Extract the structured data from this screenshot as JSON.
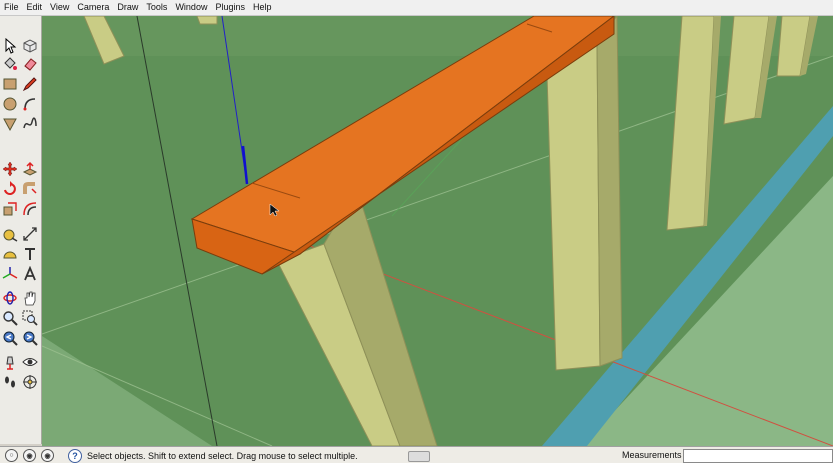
{
  "menubar": {
    "items": [
      {
        "id": "file",
        "label": "File"
      },
      {
        "id": "edit",
        "label": "Edit"
      },
      {
        "id": "view",
        "label": "View"
      },
      {
        "id": "camera",
        "label": "Camera"
      },
      {
        "id": "draw",
        "label": "Draw"
      },
      {
        "id": "tools",
        "label": "Tools"
      },
      {
        "id": "window",
        "label": "Window"
      },
      {
        "id": "plugins",
        "label": "Plugins"
      },
      {
        "id": "help",
        "label": "Help"
      }
    ]
  },
  "toolbar": {
    "tools": [
      {
        "name": "select-tool",
        "icon": "arrow"
      },
      {
        "name": "make-component-tool",
        "icon": "cube"
      },
      {
        "name": "paint-bucket-tool",
        "icon": "bucket"
      },
      {
        "name": "eraser-tool",
        "icon": "eraser"
      },
      {
        "name": "rectangle-tool",
        "icon": "rectangle"
      },
      {
        "name": "line-tool",
        "icon": "pencil"
      },
      {
        "name": "circle-tool",
        "icon": "circle"
      },
      {
        "name": "arc-tool",
        "icon": "arc"
      },
      {
        "name": "polygon-tool",
        "icon": "triangle"
      },
      {
        "name": "freehand-tool",
        "icon": "freehand"
      },
      {
        "name": "move-tool",
        "icon": "move"
      },
      {
        "name": "push-pull-tool",
        "icon": "pushpull"
      },
      {
        "name": "rotate-tool",
        "icon": "rotate"
      },
      {
        "name": "follow-me-tool",
        "icon": "followme"
      },
      {
        "name": "scale-tool",
        "icon": "scale"
      },
      {
        "name": "offset-tool",
        "icon": "offset"
      },
      {
        "name": "tape-measure-tool",
        "icon": "tape"
      },
      {
        "name": "dimension-tool",
        "icon": "dimension"
      },
      {
        "name": "protractor-tool",
        "icon": "protractor"
      },
      {
        "name": "text-tool",
        "icon": "text"
      },
      {
        "name": "axes-tool",
        "icon": "axes"
      },
      {
        "name": "3d-text-tool",
        "icon": "3dtext"
      },
      {
        "name": "orbit-tool",
        "icon": "orbit"
      },
      {
        "name": "pan-tool",
        "icon": "hand"
      },
      {
        "name": "zoom-tool",
        "icon": "magnifier"
      },
      {
        "name": "zoom-window-tool",
        "icon": "zoomwindow"
      },
      {
        "name": "previous-view-tool",
        "icon": "previous"
      },
      {
        "name": "next-view-tool",
        "icon": "next"
      },
      {
        "name": "position-camera-tool",
        "icon": "camera"
      },
      {
        "name": "look-around-tool",
        "icon": "eye"
      },
      {
        "name": "walk-tool",
        "icon": "footprints"
      },
      {
        "name": "section-plane-tool",
        "icon": "section"
      }
    ]
  },
  "colors": {
    "beam": "#e16a15",
    "beam_top": "#e57421",
    "beam_side": "#c85a10",
    "post": "#c9cc85",
    "ground": "#5f9158",
    "water": "#4f9fb0"
  },
  "status": {
    "text": "Select objects. Shift to extend select. Drag mouse to select multiple.",
    "help_glyph": "?",
    "measurements_label": "Measurements",
    "measurements_value": ""
  }
}
